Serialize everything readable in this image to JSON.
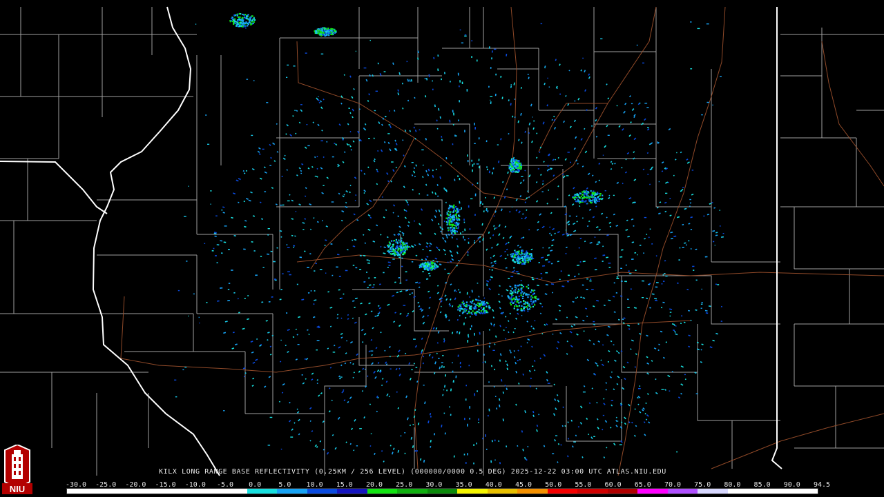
{
  "caption": "KILX LONG RANGE BASE REFLECTIVITY (0.25KM / 256 LEVEL) (000000/0000 0.5 DEG) 2025-12-22 03:00 UTC  ATLAS.NIU.EDU",
  "logo": {
    "text": "NIU",
    "icon": "niu-tower-logo-icon"
  },
  "scale": {
    "labels": [
      "-30.0",
      "-25.0",
      "-20.0",
      "-15.0",
      "-10.0",
      "-5.0",
      "0.0",
      "5.0",
      "10.0",
      "15.0",
      "20.0",
      "25.0",
      "30.0",
      "35.0",
      "40.0",
      "45.0",
      "50.0",
      "55.0",
      "60.0",
      "65.0",
      "70.0",
      "75.0",
      "80.0",
      "85.0",
      "90.0",
      "94.5"
    ],
    "colors": [
      "#ffffff",
      "#ffffff",
      "#ffffff",
      "#ffffff",
      "#ffffff",
      "#ffffff",
      "#18e0e0",
      "#17a3f5",
      "#0a4be0",
      "#1515c0",
      "#12e412",
      "#10b010",
      "#0b8a0b",
      "#f5f500",
      "#e8c000",
      "#f59100",
      "#f50000",
      "#d00000",
      "#b00000",
      "#ff00ff",
      "#b050ff",
      "#d8d8ff",
      "#ffffff",
      "#ffffff",
      "#ffffff"
    ]
  },
  "colors": {
    "background": "#000000",
    "state_lines": "#ffffff",
    "county_lines": "#bdbdbd",
    "roads": "#a0522d"
  }
}
